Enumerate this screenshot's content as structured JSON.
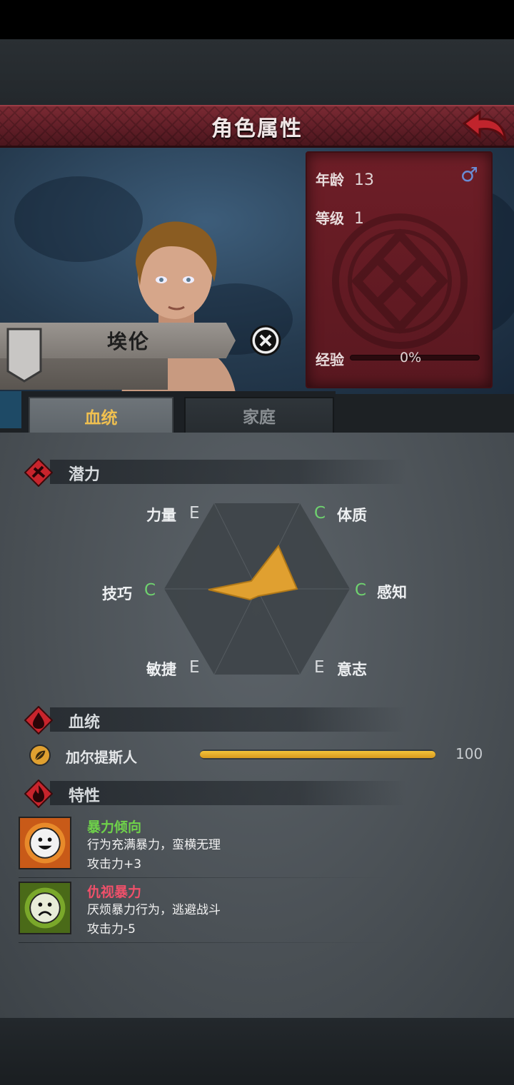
{
  "header": {
    "title": "角色属性"
  },
  "profile": {
    "name": "埃伦",
    "age_label": "年龄",
    "age": "13",
    "level_label": "等级",
    "level": "1",
    "exp_label": "经验",
    "exp_percent": "0%",
    "exp_progress": 0,
    "gender_icon": "♂"
  },
  "tabs": [
    {
      "label": "血统",
      "active": true
    },
    {
      "label": "家庭",
      "active": false
    }
  ],
  "potential": {
    "title": "潜力",
    "stats": [
      {
        "label": "力量",
        "grade": "E"
      },
      {
        "label": "体质",
        "grade": "C"
      },
      {
        "label": "感知",
        "grade": "C"
      },
      {
        "label": "意志",
        "grade": "E"
      },
      {
        "label": "敏捷",
        "grade": "E"
      },
      {
        "label": "技巧",
        "grade": "C"
      }
    ],
    "grade_colors": {
      "C": "#6fd26f",
      "E": "#d8dbde"
    },
    "radar_color": "#e0a030"
  },
  "bloodline": {
    "title": "血统",
    "entries": [
      {
        "name": "加尔提斯人",
        "value": "100",
        "progress": 1.0
      }
    ]
  },
  "traits": {
    "title": "特性",
    "items": [
      {
        "name": "暴力倾向",
        "name_color": "#6fd24a",
        "desc": "行为充满暴力，蛮横无理",
        "effect": "攻击力+3",
        "icon": "smile-face-icon"
      },
      {
        "name": "仇视暴力",
        "name_color": "#f0506a",
        "desc": "厌烦暴力行为，逃避战斗",
        "effect": "攻击力-5",
        "icon": "sad-face-icon"
      }
    ]
  }
}
